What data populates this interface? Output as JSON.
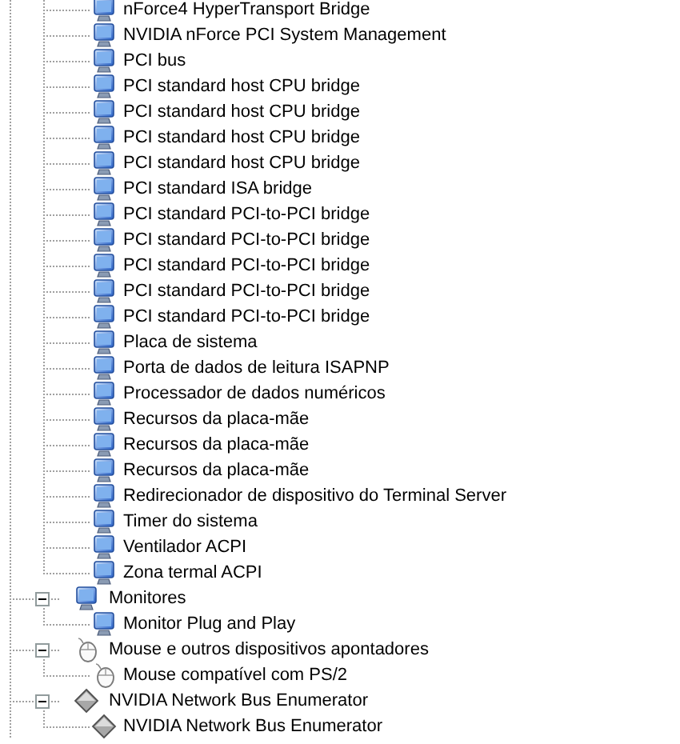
{
  "tree": [
    {
      "children": [
        {
          "label": "nForce4 HyperTransport Bridge",
          "kind": "device"
        },
        {
          "label": "NVIDIA nForce PCI System Management",
          "kind": "device"
        },
        {
          "label": "PCI bus",
          "kind": "device"
        },
        {
          "label": "PCI standard host CPU bridge",
          "kind": "device"
        },
        {
          "label": "PCI standard host CPU bridge",
          "kind": "device"
        },
        {
          "label": "PCI standard host CPU bridge",
          "kind": "device"
        },
        {
          "label": "PCI standard host CPU bridge",
          "kind": "device"
        },
        {
          "label": "PCI standard ISA bridge",
          "kind": "device"
        },
        {
          "label": "PCI standard PCI-to-PCI bridge",
          "kind": "device"
        },
        {
          "label": "PCI standard PCI-to-PCI bridge",
          "kind": "device"
        },
        {
          "label": "PCI standard PCI-to-PCI bridge",
          "kind": "device"
        },
        {
          "label": "PCI standard PCI-to-PCI bridge",
          "kind": "device"
        },
        {
          "label": "PCI standard PCI-to-PCI bridge",
          "kind": "device"
        },
        {
          "label": "Placa de sistema",
          "kind": "device"
        },
        {
          "label": "Porta de dados de leitura ISAPNP",
          "kind": "device"
        },
        {
          "label": "Processador de dados numéricos",
          "kind": "device"
        },
        {
          "label": "Recursos da placa-mãe",
          "kind": "device"
        },
        {
          "label": "Recursos da placa-mãe",
          "kind": "device"
        },
        {
          "label": "Recursos da placa-mãe",
          "kind": "device"
        },
        {
          "label": "Redirecionador de dispositivo do Terminal Server",
          "kind": "device"
        },
        {
          "label": "Timer do sistema",
          "kind": "device"
        },
        {
          "label": "Ventilador ACPI",
          "kind": "device"
        },
        {
          "label": "Zona termal ACPI",
          "kind": "device"
        }
      ]
    },
    {
      "label": "Monitores",
      "kind": "device",
      "expanded": true,
      "children": [
        {
          "label": "Monitor Plug and Play",
          "kind": "device"
        }
      ]
    },
    {
      "label": "Mouse e outros dispositivos apontadores",
      "kind": "mouse",
      "expanded": true,
      "children": [
        {
          "label": "Mouse compatível com PS/2",
          "kind": "mouse"
        }
      ]
    },
    {
      "label": "NVIDIA Network Bus Enumerator",
      "kind": "network",
      "expanded": true,
      "children": [
        {
          "label": "NVIDIA Network Bus Enumerator",
          "kind": "network"
        }
      ]
    }
  ]
}
